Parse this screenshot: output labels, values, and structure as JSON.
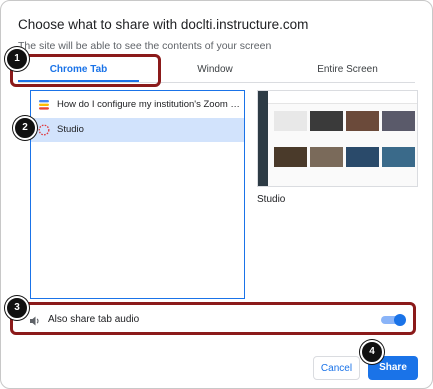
{
  "dialog": {
    "title": "Choose what to share with doclti.instructure.com",
    "subtitle": "The site will be able to see the contents of your screen"
  },
  "tabs": [
    {
      "label": "Chrome Tab",
      "active": true
    },
    {
      "label": "Window",
      "active": false
    },
    {
      "label": "Entire Screen",
      "active": false
    }
  ],
  "tab_list": [
    {
      "title": "How do I configure my institution's Zoom a...",
      "icon": "canvas-icon",
      "selected": false
    },
    {
      "title": "Studio",
      "icon": "studio-icon",
      "selected": true
    }
  ],
  "preview": {
    "label": "Studio"
  },
  "audio": {
    "label": "Also share tab audio",
    "enabled": true
  },
  "buttons": {
    "cancel": "Cancel",
    "share": "Share"
  },
  "callouts": [
    "1",
    "2",
    "3",
    "4"
  ],
  "colors": {
    "accent": "#1a73e8",
    "selected_bg": "#d2e3fc",
    "highlight": "#8b1a1a"
  }
}
